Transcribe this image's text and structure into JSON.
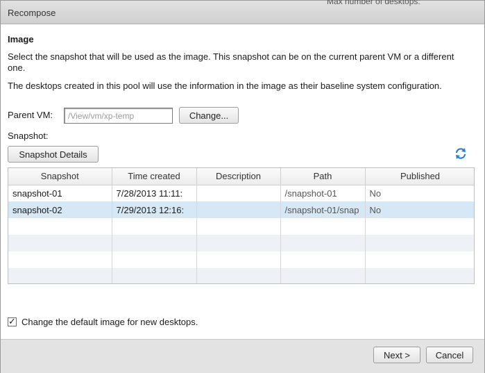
{
  "window": {
    "title": "Recompose",
    "background_text": "Max number of desktops:"
  },
  "image_section": {
    "title": "Image",
    "desc1": "Select the snapshot that will be used as the image. This snapshot can be on the current parent VM or a different one.",
    "desc2": "The desktops created in this pool will use the information in the image as their baseline system configuration.",
    "parent_vm_label": "Parent VM:",
    "parent_vm_value": "/View/vm/xp-temp",
    "change_button": "Change...",
    "snapshot_label": "Snapshot:",
    "snapshot_details_button": "Snapshot Details"
  },
  "table": {
    "columns": [
      "Snapshot",
      "Time created",
      "Description",
      "Path",
      "Published"
    ],
    "rows": [
      {
        "snapshot": "snapshot-01",
        "time": "7/28/2013 11:11:",
        "description": "",
        "path": "/snapshot-01",
        "published": "No"
      },
      {
        "snapshot": "snapshot-02",
        "time": "7/29/2013 12:16:",
        "description": "",
        "path": "/snapshot-01/snap",
        "published": "No",
        "selected": true
      }
    ]
  },
  "checkbox": {
    "label": "Change the default image for new desktops.",
    "checked": true
  },
  "footer": {
    "next_button": "Next >",
    "cancel_button": "Cancel"
  },
  "colors": {
    "selected_row": "#d6e8f5",
    "alt_row": "#eef2f7",
    "footer_bg": "#e3e3e3",
    "accent": "#2a7fc8"
  },
  "icons": {
    "refresh": "refresh-icon",
    "checkmark": "checkmark-icon"
  }
}
